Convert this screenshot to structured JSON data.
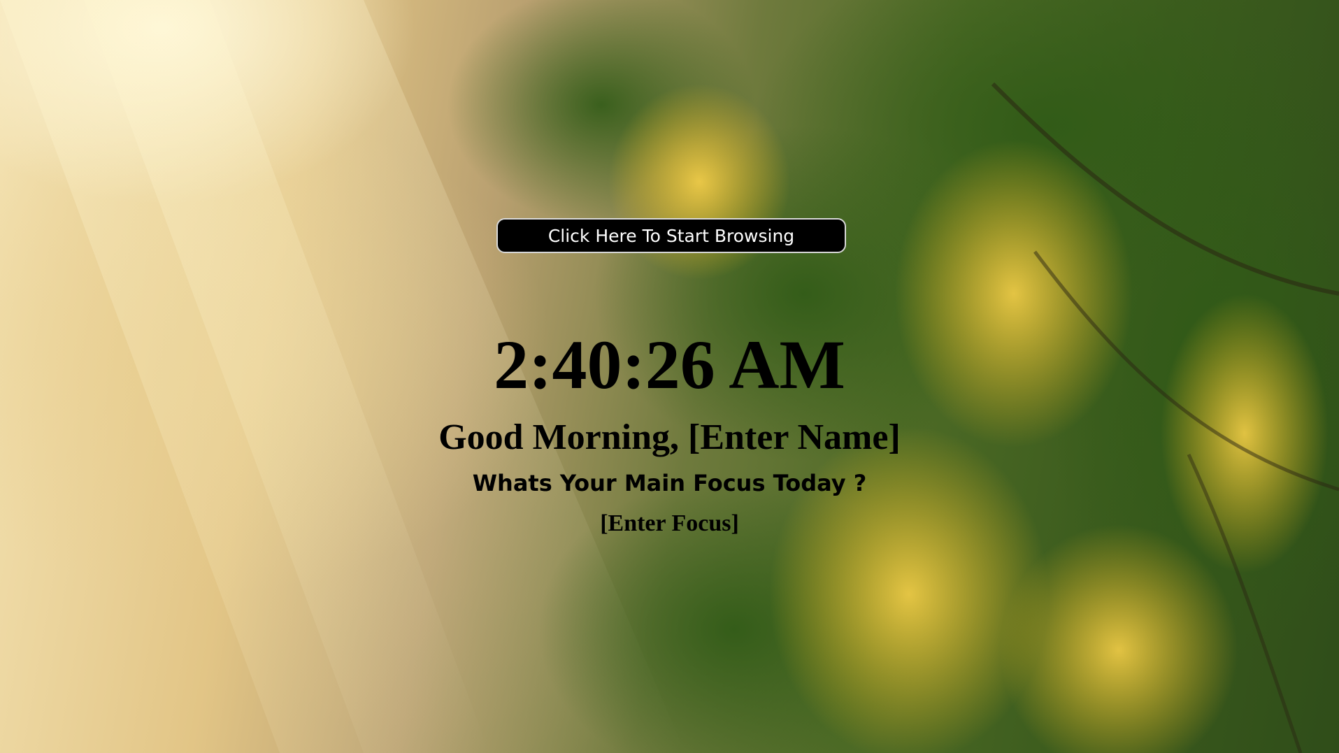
{
  "start_button": {
    "label": "Click Here To Start Browsing"
  },
  "clock": {
    "time": "2:40:26 AM"
  },
  "greeting": {
    "text": "Good Morning, ",
    "name_placeholder": "[Enter Name]"
  },
  "focus": {
    "question": "Whats Your Main Focus Today ?",
    "placeholder": "[Enter Focus]"
  },
  "background": {
    "description_icon": "forest-sunlight-background"
  }
}
